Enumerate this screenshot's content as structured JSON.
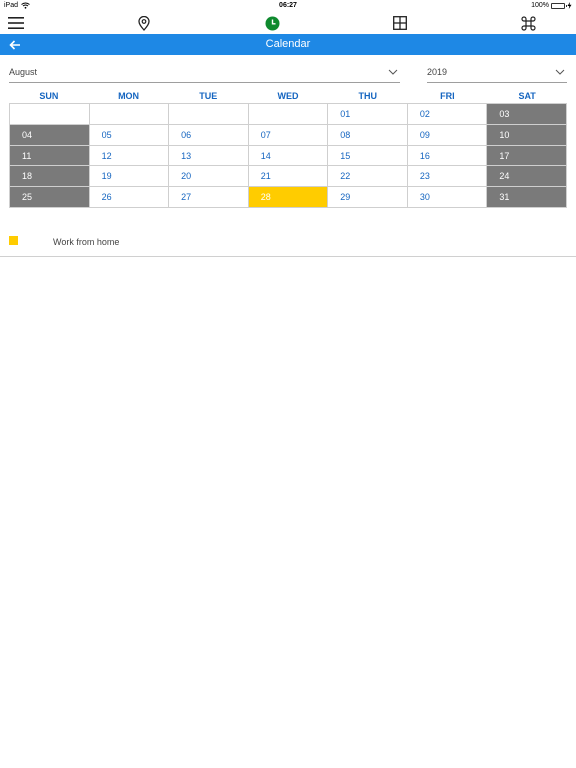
{
  "status_bar": {
    "device": "iPad",
    "time": "06:27",
    "battery": "100%",
    "battery_level": 1.0
  },
  "toolbar": {
    "icons": [
      "menu-icon",
      "location-pin-icon",
      "clock-icon",
      "grid-plus-icon",
      "command-icon"
    ],
    "clock_color": "#0f8a2e"
  },
  "header": {
    "title": "Calendar",
    "background": "#1e88e5"
  },
  "filters": {
    "month": "August",
    "year": "2019"
  },
  "calendar": {
    "weekdays": [
      "SUN",
      "MON",
      "TUE",
      "WED",
      "THU",
      "FRI",
      "SAT"
    ],
    "weeks": [
      [
        {
          "day": "",
          "type": "empty"
        },
        {
          "day": "",
          "type": "empty"
        },
        {
          "day": "",
          "type": "empty"
        },
        {
          "day": "",
          "type": "empty"
        },
        {
          "day": "01",
          "type": "normal"
        },
        {
          "day": "02",
          "type": "normal"
        },
        {
          "day": "03",
          "type": "weekend"
        }
      ],
      [
        {
          "day": "04",
          "type": "weekend"
        },
        {
          "day": "05",
          "type": "normal"
        },
        {
          "day": "06",
          "type": "normal"
        },
        {
          "day": "07",
          "type": "normal"
        },
        {
          "day": "08",
          "type": "normal"
        },
        {
          "day": "09",
          "type": "normal"
        },
        {
          "day": "10",
          "type": "weekend"
        }
      ],
      [
        {
          "day": "11",
          "type": "weekend"
        },
        {
          "day": "12",
          "type": "normal"
        },
        {
          "day": "13",
          "type": "normal"
        },
        {
          "day": "14",
          "type": "normal"
        },
        {
          "day": "15",
          "type": "normal"
        },
        {
          "day": "16",
          "type": "normal"
        },
        {
          "day": "17",
          "type": "weekend"
        }
      ],
      [
        {
          "day": "18",
          "type": "weekend"
        },
        {
          "day": "19",
          "type": "normal"
        },
        {
          "day": "20",
          "type": "normal"
        },
        {
          "day": "21",
          "type": "normal"
        },
        {
          "day": "22",
          "type": "normal"
        },
        {
          "day": "23",
          "type": "normal"
        },
        {
          "day": "24",
          "type": "weekend"
        }
      ],
      [
        {
          "day": "25",
          "type": "weekend"
        },
        {
          "day": "26",
          "type": "normal"
        },
        {
          "day": "27",
          "type": "normal"
        },
        {
          "day": "28",
          "type": "wfh"
        },
        {
          "day": "29",
          "type": "normal"
        },
        {
          "day": "30",
          "type": "normal"
        },
        {
          "day": "31",
          "type": "weekend"
        }
      ]
    ],
    "colors": {
      "weekend": "#7a7a7a",
      "wfh": "#ffcc00",
      "day_text": "#1565c0"
    }
  },
  "legend": {
    "items": [
      {
        "label": "Work from home",
        "color": "#ffcc00"
      }
    ]
  }
}
